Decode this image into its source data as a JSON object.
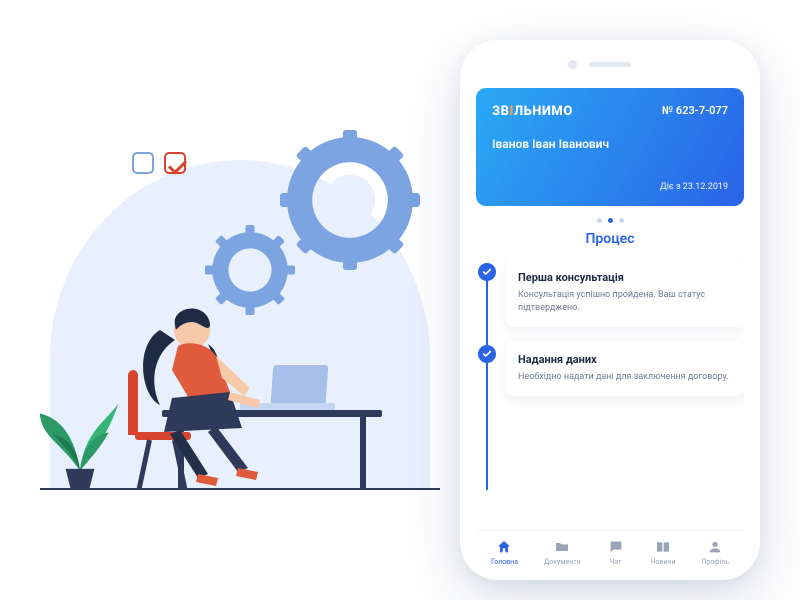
{
  "card": {
    "brand_pre": "ЗВ",
    "brand_accent": "І",
    "brand_post": "ЛЬНИМО",
    "case_number": "№ 623-7-077",
    "holder": "Іванов Іван Іванович",
    "valid_from": "Діє з 23.12.2019"
  },
  "carousel": {
    "active_index": 1,
    "count": 3
  },
  "section_title": "Процес",
  "steps": [
    {
      "title": "Перша консультація",
      "desc": "Консультація успішно пройдена. Ваш статус підтверджено."
    },
    {
      "title": "Надання даних",
      "desc": "Необхідно надати дані для заключення договору."
    }
  ],
  "tabs": [
    {
      "label": "Головна"
    },
    {
      "label": "Документи"
    },
    {
      "label": "Чат"
    },
    {
      "label": "Новини"
    },
    {
      "label": "Профіль"
    }
  ],
  "active_tab": 0
}
